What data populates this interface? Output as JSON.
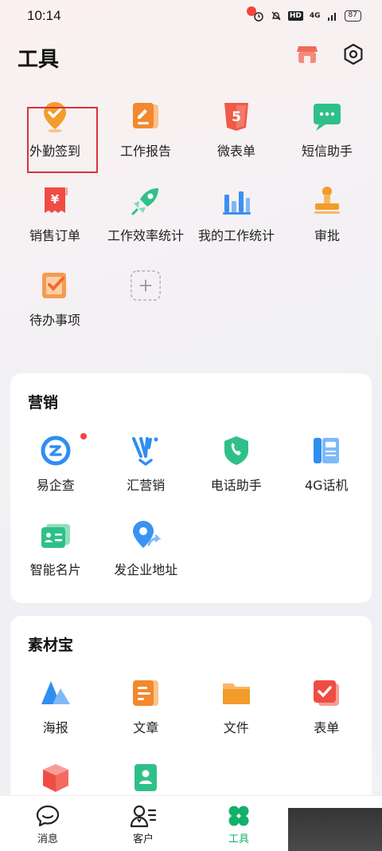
{
  "status": {
    "time": "10:14",
    "battery": "87",
    "network": "4G",
    "hd": "HD"
  },
  "header": {
    "title": "工具"
  },
  "tools": [
    {
      "label": "外勤签到",
      "icon": "location-check-icon"
    },
    {
      "label": "工作报告",
      "icon": "report-edit-icon"
    },
    {
      "label": "微表单",
      "icon": "html5-form-icon"
    },
    {
      "label": "短信助手",
      "icon": "sms-icon"
    },
    {
      "label": "销售订单",
      "icon": "sales-order-icon"
    },
    {
      "label": "工作效率统计",
      "icon": "rocket-icon"
    },
    {
      "label": "我的工作统计",
      "icon": "bar-chart-icon"
    },
    {
      "label": "审批",
      "icon": "stamp-icon"
    },
    {
      "label": "待办事项",
      "icon": "todo-check-icon"
    }
  ],
  "marketing": {
    "title": "营销",
    "items": [
      {
        "label": "易企查",
        "icon": "company-search-icon"
      },
      {
        "label": "汇营销",
        "icon": "marketing-v-icon"
      },
      {
        "label": "电话助手",
        "icon": "phone-shield-icon"
      },
      {
        "label": "4G话机",
        "icon": "desk-phone-icon"
      },
      {
        "label": "智能名片",
        "icon": "business-card-icon"
      },
      {
        "label": "发企业地址",
        "icon": "share-location-icon"
      }
    ]
  },
  "materials": {
    "title": "素材宝",
    "items": [
      {
        "label": "海报",
        "icon": "poster-icon"
      },
      {
        "label": "文章",
        "icon": "article-icon"
      },
      {
        "label": "文件",
        "icon": "folder-icon"
      },
      {
        "label": "表单",
        "icon": "form-icon"
      }
    ]
  },
  "tabbar": [
    {
      "label": "消息",
      "icon": "message-icon"
    },
    {
      "label": "客户",
      "icon": "customer-icon"
    },
    {
      "label": "工具",
      "icon": "clover-icon"
    }
  ],
  "colors": {
    "accent": "#13b06a",
    "highlight": "#d9323c",
    "badge": "#f2453d"
  }
}
